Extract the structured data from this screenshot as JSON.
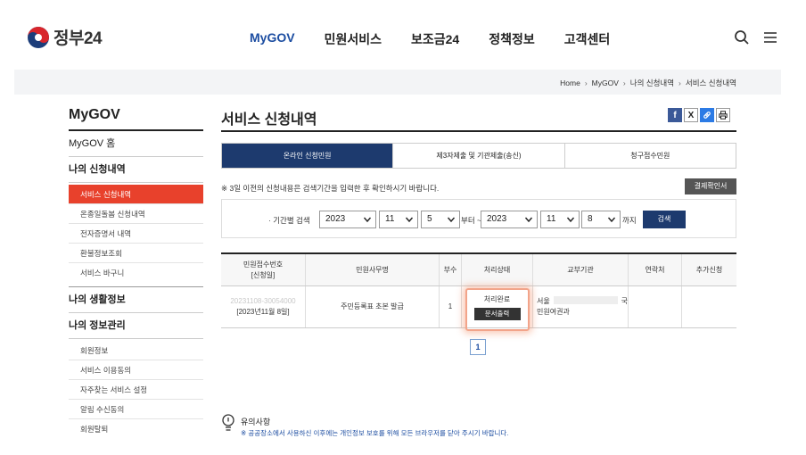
{
  "header": {
    "logo_text": "정부24",
    "nav": [
      "MyGOV",
      "민원서비스",
      "보조금24",
      "정책정보",
      "고객센터"
    ],
    "nav_active": 0
  },
  "breadcrumb": [
    "Home",
    "MyGOV",
    "나의 신청내역",
    "서비스 신청내역"
  ],
  "sidebar": {
    "title": "MyGOV",
    "home": "MyGOV 홈",
    "group1": "나의 신청내역",
    "group1_items": [
      "서비스 신청내역",
      "온종일돌봄 신청내역",
      "전자증명서 내역",
      "환불정보조회",
      "서비스 바구니"
    ],
    "group2": "나의 생활정보",
    "group3": "나의 정보관리",
    "group3_items": [
      "회원정보",
      "서비스 이용동의",
      "자주찾는 서비스 설정",
      "알림 수신동의",
      "회원탈퇴"
    ]
  },
  "main": {
    "title": "서비스 신청내역",
    "tabs": [
      "온라인 신청민원",
      "제3자제출 및 기관제출(송신)",
      "청구접수민원"
    ],
    "notice": "※ 3일 이전의 신청내용은 검색기간을 입력한 후 확인하시기 바랍니다.",
    "receipt_button": "결제확인서",
    "search": {
      "label": "· 기간별 검색",
      "from_year": "2023",
      "from_month": "11",
      "from_day": "5",
      "from_suffix": "부터 ~",
      "to_year": "2023",
      "to_month": "11",
      "to_day": "8",
      "to_suffix": "까지",
      "button": "검색"
    },
    "table": {
      "headers": {
        "receipt_no": "민원접수번호",
        "apply_date": "[신청일]",
        "affair": "민원사무명",
        "count": "부수",
        "status": "처리상태",
        "agency": "교부기관",
        "contact": "연락처",
        "extra": "추가신청"
      },
      "row": {
        "receipt_no": "20231108-30054000",
        "apply_date": "[2023년11월 8일]",
        "affair": "주민등록표 초본 발급",
        "count": "1",
        "status": "처리완료",
        "print_button": "문서출력",
        "agency_line1_start": "서울",
        "agency_line1_end": "국",
        "agency_line2": "민원여권과",
        "contact": "",
        "extra": ""
      }
    },
    "page": "1"
  },
  "caution": {
    "title": "유의사항",
    "text": "※ 공공장소에서 사용하신 이후에는 개인정보 보호를 위해 모든 브라우저를 닫아 주시기 바랍니다."
  }
}
